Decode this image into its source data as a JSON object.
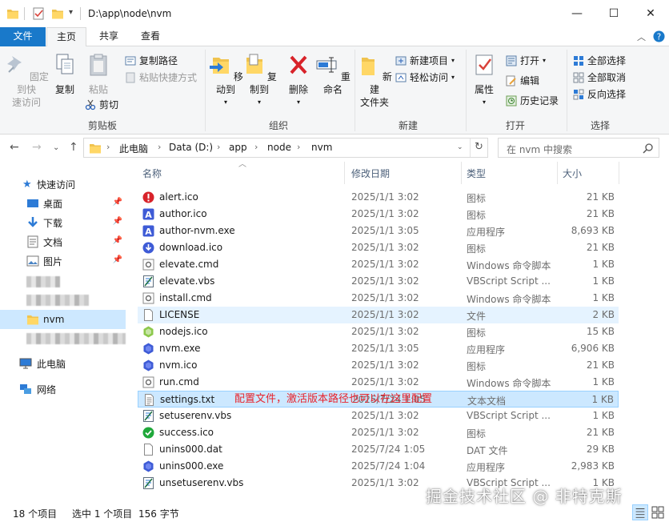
{
  "window": {
    "title": "D:\\app\\node\\nvm",
    "controls": {
      "minimize": "—",
      "maximize": "☐",
      "close": "✕"
    }
  },
  "tabs": [
    {
      "label": "文件"
    },
    {
      "label": "主页"
    },
    {
      "label": "共享"
    },
    {
      "label": "查看"
    }
  ],
  "ribbon": {
    "clipboard": {
      "label": "剪贴板",
      "pin": "固定到快\n速访问",
      "copy": "复制",
      "paste": "粘贴",
      "copy_path": "复制路径",
      "paste_shortcut": "粘贴快捷方式",
      "cut": "剪切"
    },
    "organize": {
      "label": "组织",
      "move_to": "移动到",
      "copy_to": "复制到",
      "delete": "删除",
      "rename": "重命名"
    },
    "new": {
      "label": "新建",
      "new_folder": "新建\n文件夹",
      "new_item": "新建项目",
      "easy_access": "轻松访问"
    },
    "open": {
      "label": "打开",
      "properties": "属性",
      "open": "打开",
      "edit": "编辑",
      "history": "历史记录"
    },
    "select": {
      "label": "选择",
      "select_all": "全部选择",
      "select_none": "全部取消",
      "invert": "反向选择"
    }
  },
  "address": {
    "crumbs": [
      "此电脑",
      "Data (D:)",
      "app",
      "node",
      "nvm"
    ],
    "search_placeholder": "在 nvm 中搜索"
  },
  "navpane": {
    "quick_access": "快速访问",
    "desktop": "桌面",
    "downloads": "下载",
    "documents": "文档",
    "pictures": "图片",
    "nvm": "nvm",
    "this_pc": "此电脑",
    "network": "网络"
  },
  "columns": {
    "name": "名称",
    "date": "修改日期",
    "type": "类型",
    "size": "大小"
  },
  "files": [
    {
      "name": "alert.ico",
      "date": "2025/1/1 3:02",
      "type": "图标",
      "size": "21 KB",
      "icon": "alert-icon"
    },
    {
      "name": "author.ico",
      "date": "2025/1/1 3:02",
      "type": "图标",
      "size": "21 KB",
      "icon": "author-icon"
    },
    {
      "name": "author-nvm.exe",
      "date": "2025/1/1 3:05",
      "type": "应用程序",
      "size": "8,693 KB",
      "icon": "author-icon"
    },
    {
      "name": "download.ico",
      "date": "2025/1/1 3:02",
      "type": "图标",
      "size": "21 KB",
      "icon": "download-icon"
    },
    {
      "name": "elevate.cmd",
      "date": "2025/1/1 3:02",
      "type": "Windows 命令脚本",
      "size": "1 KB",
      "icon": "cmd-icon"
    },
    {
      "name": "elevate.vbs",
      "date": "2025/1/1 3:02",
      "type": "VBScript Script ...",
      "size": "1 KB",
      "icon": "vbs-icon"
    },
    {
      "name": "install.cmd",
      "date": "2025/1/1 3:02",
      "type": "Windows 命令脚本",
      "size": "1 KB",
      "icon": "cmd-icon"
    },
    {
      "name": "LICENSE",
      "date": "2025/1/1 3:02",
      "type": "文件",
      "size": "2 KB",
      "icon": "blank-file-icon"
    },
    {
      "name": "nodejs.ico",
      "date": "2025/1/1 3:02",
      "type": "图标",
      "size": "15 KB",
      "icon": "nodejs-icon"
    },
    {
      "name": "nvm.exe",
      "date": "2025/1/1 3:05",
      "type": "应用程序",
      "size": "6,906 KB",
      "icon": "nvm-icon"
    },
    {
      "name": "nvm.ico",
      "date": "2025/1/1 3:02",
      "type": "图标",
      "size": "21 KB",
      "icon": "nvm-icon"
    },
    {
      "name": "run.cmd",
      "date": "2025/1/1 3:02",
      "type": "Windows 命令脚本",
      "size": "1 KB",
      "icon": "cmd-icon"
    },
    {
      "name": "settings.txt",
      "date": "2025/7/24 1:05",
      "type": "文本文档",
      "size": "1 KB",
      "icon": "text-file-icon"
    },
    {
      "name": "setuserenv.vbs",
      "date": "2025/1/1 3:02",
      "type": "VBScript Script ...",
      "size": "1 KB",
      "icon": "vbs-icon"
    },
    {
      "name": "success.ico",
      "date": "2025/1/1 3:02",
      "type": "图标",
      "size": "21 KB",
      "icon": "success-icon"
    },
    {
      "name": "unins000.dat",
      "date": "2025/7/24 1:05",
      "type": "DAT 文件",
      "size": "29 KB",
      "icon": "blank-file-icon"
    },
    {
      "name": "unins000.exe",
      "date": "2025/7/24 1:04",
      "type": "应用程序",
      "size": "2,983 KB",
      "icon": "nvm-icon"
    },
    {
      "name": "unsetuserenv.vbs",
      "date": "2025/1/1 3:02",
      "type": "VBScript Script ...",
      "size": "1 KB",
      "icon": "vbs-icon"
    }
  ],
  "annotation": "配置文件，激活版本路径也可以在这里配置",
  "watermark": "掘金技术社区 @ 非特克斯",
  "status": {
    "count": "18 个项目",
    "selection": "选中 1 个项目",
    "bytes": "156 字节"
  },
  "colors": {
    "accent": "#1979ca",
    "selection": "#cce8ff",
    "annotation": "#e8232b"
  }
}
